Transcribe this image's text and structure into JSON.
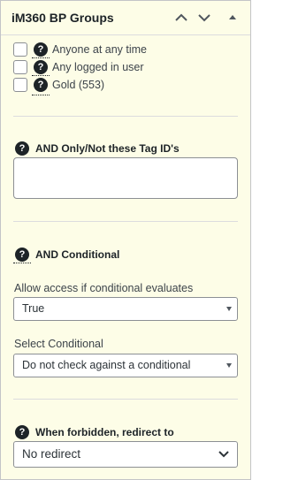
{
  "panel": {
    "title": "iM360 BP Groups",
    "controls": {
      "move_up": "arrow-up-icon",
      "move_down": "arrow-down-icon",
      "toggle": "toggle-panel-icon"
    }
  },
  "access_options": [
    {
      "label": "Anyone at any time",
      "checked": false
    },
    {
      "label": "Any logged in user",
      "checked": false
    },
    {
      "label": "Gold (553)",
      "checked": false
    }
  ],
  "tag_ids": {
    "label": "AND Only/Not these Tag ID's",
    "value": ""
  },
  "conditional": {
    "heading": "AND Conditional",
    "allow_label": "Allow access if conditional evaluates",
    "allow_value": "True",
    "select_label": "Select Conditional",
    "select_value": "Do not check against a conditional"
  },
  "redirect": {
    "label": "When forbidden, redirect to",
    "value": "No redirect"
  },
  "help_glyph": "?"
}
